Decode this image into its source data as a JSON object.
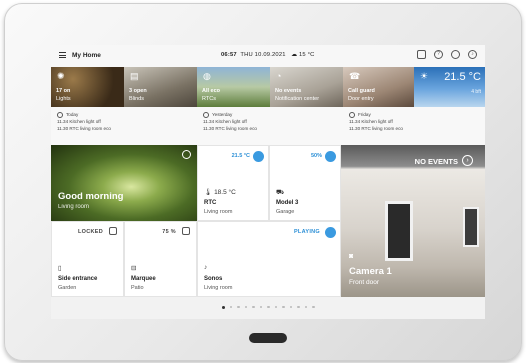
{
  "statusbar": {
    "title": "My Home",
    "time": "06:57",
    "date": "THU 10.09.2021",
    "weather": "15 °C"
  },
  "top_tiles": [
    {
      "line1": "17 on",
      "line2": "Lights"
    },
    {
      "line1": "3 open",
      "line2": "Blinds"
    },
    {
      "line1": "All eco",
      "line2": "RTCs"
    },
    {
      "line1": "No events",
      "line2": "Notification center"
    },
    {
      "line1": "Call guard",
      "line2": "Door entry"
    },
    {
      "temp": "21.5 °C",
      "sub": "4 bft"
    }
  ],
  "notes": [
    {
      "title": "Today",
      "line1": "11.34 Kitchen light off",
      "line2": "11.30 RTC living room eco"
    },
    {
      "title": "Yesterday",
      "line1": "11.34 Kitchen light off",
      "line2": "11.30 RTC living room eco"
    },
    {
      "title": "Friday",
      "line1": "11.34 Kitchen light off",
      "line2": "11.30 RTC living room eco"
    }
  ],
  "scene": {
    "title": "Good morning",
    "sub": "Living room"
  },
  "rtc": {
    "setpoint": "21.5 °C",
    "current": "18.5 °C",
    "title": "RTC",
    "sub": "Living room"
  },
  "model": {
    "value": "50%",
    "title": "Model 3",
    "sub": "Garage"
  },
  "camera": {
    "status": "NO EVENTS",
    "title": "Camera 1",
    "sub": "Front door"
  },
  "side": {
    "state": "LOCKED",
    "title": "Side entrance",
    "sub": "Garden"
  },
  "marquee": {
    "state": "75 %",
    "title": "Marquee",
    "sub": "Patio"
  },
  "sonos": {
    "state": "PLAYING",
    "title": "Sonos",
    "sub": "Living room"
  },
  "pagination": {
    "total": 13,
    "current": 1
  },
  "colors": {
    "accent": "#3a9ae0",
    "background": "#f2f2f2"
  }
}
